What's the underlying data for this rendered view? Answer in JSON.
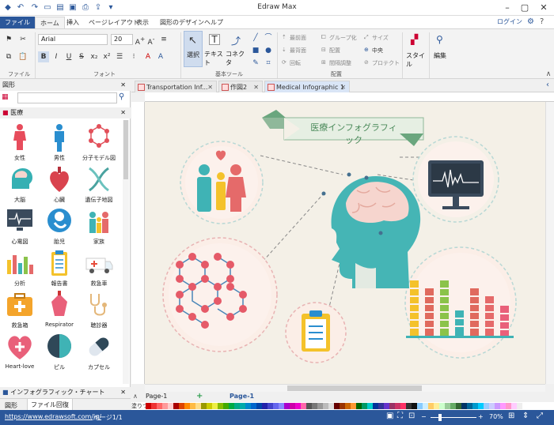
{
  "app": {
    "title": "Edraw Max"
  },
  "menu": {
    "file": "ファイル",
    "items": [
      "ホーム",
      "挿入",
      "ページレイアウト",
      "表示",
      "図形のデザイン",
      "ヘルプ"
    ],
    "login": "ログイン"
  },
  "ribbon": {
    "font_name": "Arial",
    "font_size": "20",
    "groups": {
      "file": "ファイル",
      "font": "フォント",
      "basic_tools": "基本ツール",
      "arrange": "配置"
    },
    "tools": {
      "select": "選択",
      "text": "テキスト",
      "connector": "コネクタ"
    },
    "arrange_items": [
      "最前面",
      "グループ化",
      "サイズ",
      "最背面",
      "配置",
      "中央",
      "回転",
      "間隔調整",
      "プロテクト"
    ],
    "style": "スタイル",
    "edit": "編集"
  },
  "panel": {
    "title": "図形",
    "category": "医療",
    "symbols": [
      "女性",
      "男性",
      "分子モデル図",
      "大脳",
      "心臓",
      "遺伝子地図",
      "心電図",
      "胎児",
      "家族",
      "分析",
      "報告書",
      "救急車",
      "救急箱",
      "Respirator",
      "聴診器",
      "Heart-love",
      "ピル",
      "カプセル"
    ],
    "bottom_section": "インフォグラフィック・チャート",
    "bottom_tabs": [
      "図形",
      "ファイル回復"
    ]
  },
  "doc_tabs": [
    "Transportation Inf...",
    "作図2",
    "Medical Infographic 1"
  ],
  "canvas": {
    "banner_text": "医療インフォグラフィック"
  },
  "page_bar": {
    "page_tab": "Page-1",
    "page_current": "Page-1",
    "fill_label": "塗りつぶし"
  },
  "status": {
    "url": "https://www.edrawsoft.com/jp/",
    "page": "ページ1/1",
    "zoom": "70%"
  }
}
